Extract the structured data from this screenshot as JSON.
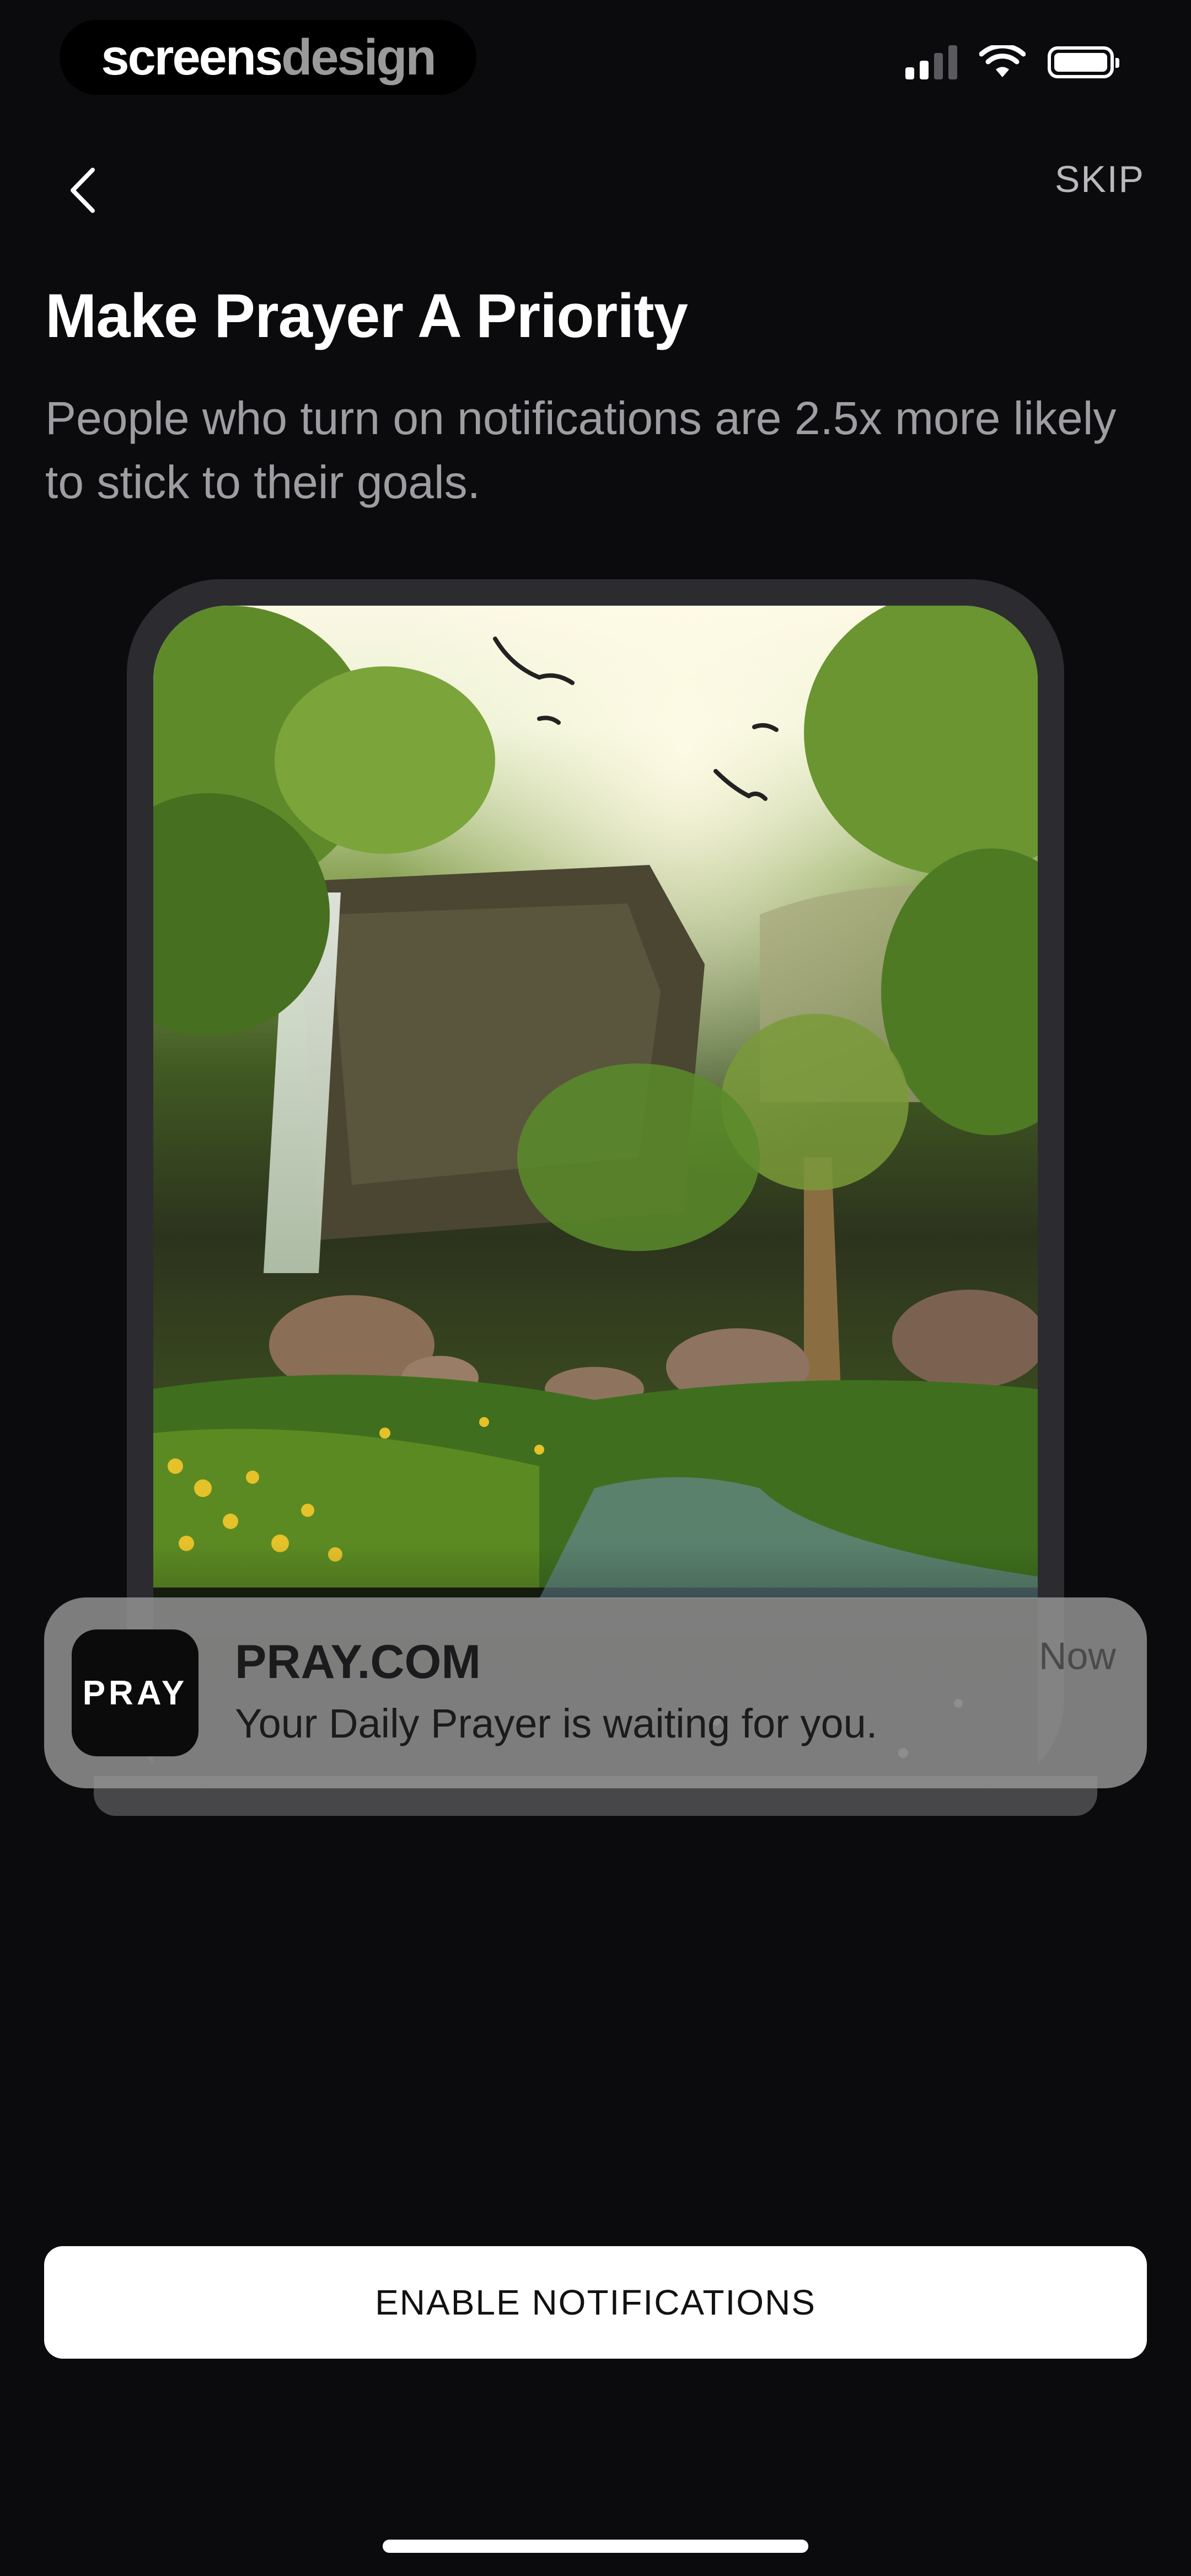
{
  "watermark": {
    "part1": "screens",
    "part2": "design"
  },
  "nav": {
    "skip_label": "SKIP"
  },
  "header": {
    "title": "Make Prayer A Priority",
    "subtitle": "People who turn on notifications are 2.5x more likely to stick to their goals."
  },
  "notification": {
    "app_icon_label": "PRAY",
    "app_name": "PRAY.COM",
    "message": "Your Daily Prayer is waiting for you.",
    "time": "Now"
  },
  "cta": {
    "label": "ENABLE NOTIFICATIONS"
  },
  "icons": {
    "back": "chevron-left-icon",
    "signal": "cellular-signal-icon",
    "wifi": "wifi-icon",
    "battery": "battery-icon"
  },
  "colors": {
    "background": "#0b0b0d",
    "title": "#ffffff",
    "subtitle": "#9d9da2",
    "button_bg": "#ffffff",
    "notification_bg": "#969696"
  }
}
